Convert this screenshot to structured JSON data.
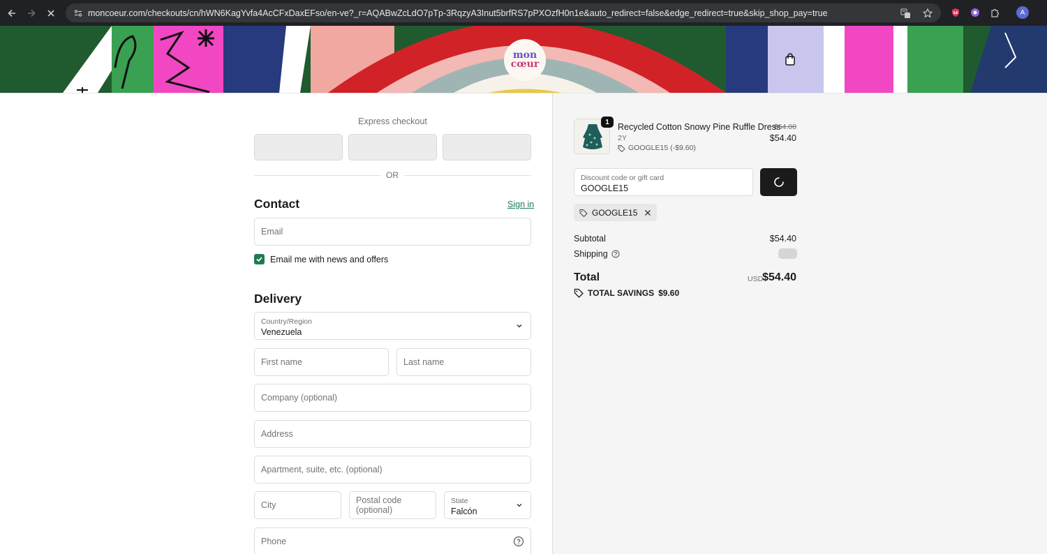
{
  "browser": {
    "url": "moncoeur.com/checkouts/cn/hWN6KagYvfa4AcCFxDaxEFso/en-ve?_r=AQABwZcLdO7pTp-3RqzyA3Inut5brfRS7pPXOzfH0n1e&auto_redirect=false&edge_redirect=true&skip_shop_pay=true",
    "avatar_letter": "A"
  },
  "brand": {
    "logo_top": "mon",
    "logo_bottom": "cœur"
  },
  "express": {
    "label": "Express checkout",
    "or": "OR"
  },
  "contact": {
    "title": "Contact",
    "sign_in": "Sign in",
    "email_placeholder": "Email",
    "newsletter_label": "Email me with news and offers",
    "newsletter_checked": true
  },
  "delivery": {
    "title": "Delivery",
    "country_label": "Country/Region",
    "country_value": "Venezuela",
    "first_name": "First name",
    "last_name": "Last name",
    "company": "Company (optional)",
    "address": "Address",
    "apartment": "Apartment, suite, etc. (optional)",
    "city": "City",
    "postal": "Postal code (optional)",
    "state_label": "State",
    "state_value": "Falcón",
    "phone": "Phone"
  },
  "summary": {
    "item": {
      "quantity": "1",
      "name": "Recycled Cotton Snowy Pine Ruffle Dress",
      "variant": "2Y",
      "discount": "GOOGLE15 (-$9.60)",
      "price_old": "$64.00",
      "price_new": "$54.40"
    },
    "discount_label": "Discount code or gift card",
    "discount_value": "GOOGLE15",
    "applied_code": "GOOGLE15",
    "subtotal_label": "Subtotal",
    "subtotal_value": "$54.40",
    "shipping_label": "Shipping",
    "total_label": "Total",
    "currency": "USD",
    "total_value": "$54.40",
    "savings_label": "TOTAL SAVINGS",
    "savings_value": "$9.60"
  },
  "colors": {
    "accent_green": "#1f7a53",
    "link_green": "#197b5b",
    "dark_button": "#1b1b1b"
  }
}
